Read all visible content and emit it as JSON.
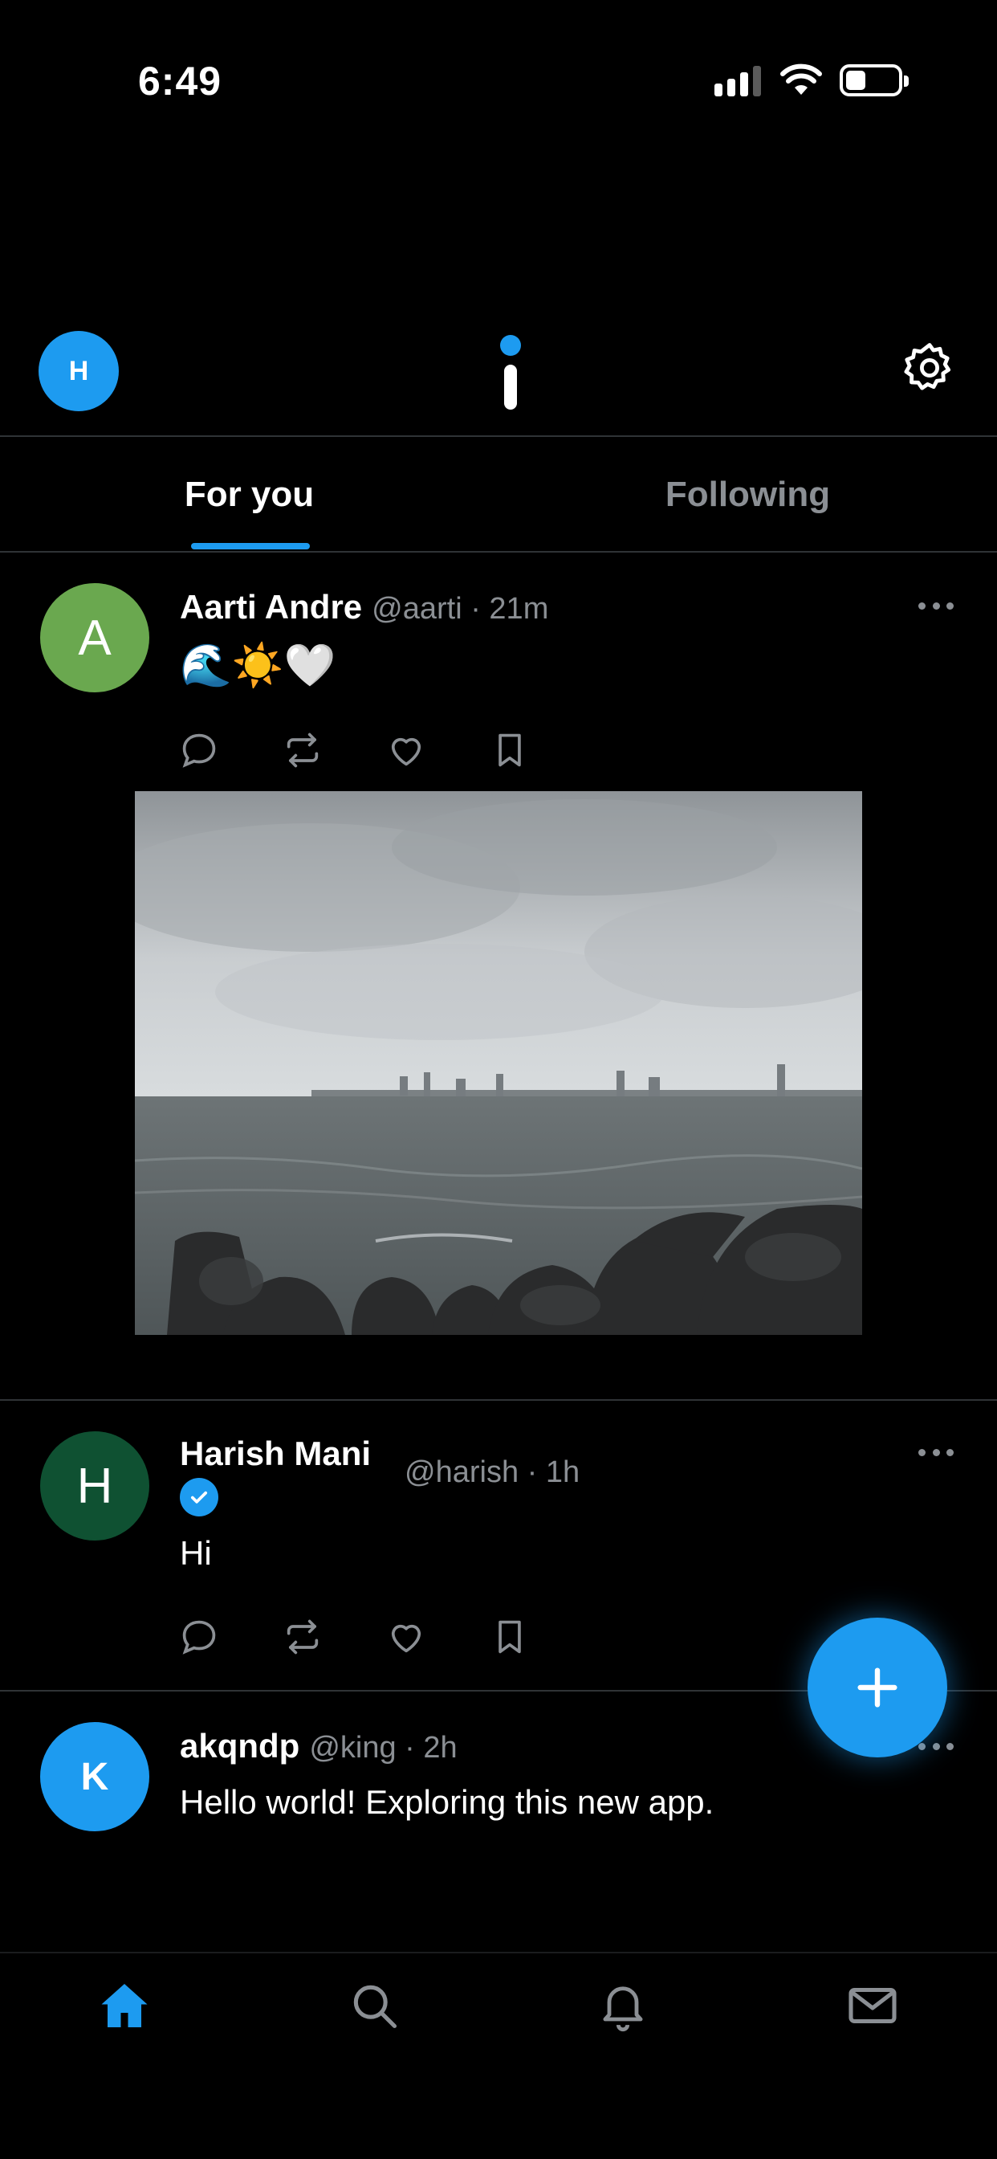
{
  "status_bar": {
    "time": "6:49"
  },
  "header": {
    "avatar_initial": "H"
  },
  "tabs": [
    {
      "label": "For you",
      "active": true
    },
    {
      "label": "Following",
      "active": false
    }
  ],
  "posts": [
    {
      "avatar_initial": "A",
      "avatar_color": "#6aa84f",
      "name": "Aarti Andre",
      "handle_time": "@aarti · 21m",
      "text": "🌊☀️🤍",
      "has_image": true,
      "image_desc_icon": "seascape-photo"
    },
    {
      "avatar_initial": "H",
      "avatar_color": "#0f5132",
      "name": "Harish Mani",
      "verified": true,
      "handle_time": "@harish · 1h",
      "text": "Hi"
    },
    {
      "avatar_initial": "K",
      "avatar_color": "#1d9bf0",
      "name": "akqndp",
      "handle_time": "@king · 2h",
      "text": "Hello world! Exploring this new app."
    }
  ],
  "actions": [
    "reply-icon",
    "repost-icon",
    "like-icon",
    "bookmark-icon"
  ],
  "bottom_nav": [
    "home-icon",
    "search-icon",
    "notifications-icon",
    "messages-icon"
  ],
  "colors": {
    "accent": "#1d9bf0",
    "muted": "#8b8f94",
    "divider": "#2f3336"
  }
}
